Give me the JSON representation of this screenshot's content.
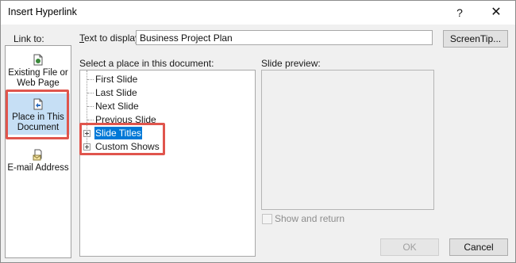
{
  "window": {
    "title": "Insert Hyperlink",
    "help_glyph": "?",
    "close_glyph": "✕"
  },
  "link_to": {
    "label": "Link to:",
    "items": [
      {
        "label": "Existing File or Web Page",
        "icon": "file-globe-icon",
        "selected": false
      },
      {
        "label": "Place in This Document",
        "icon": "document-place-icon",
        "selected": true
      },
      {
        "label": "E-mail Address",
        "icon": "email-icon",
        "selected": false
      }
    ]
  },
  "text_to_display": {
    "label": "Text to display:",
    "value": "Business Project Plan"
  },
  "screentip_label": "ScreenTip...",
  "place": {
    "label": "Select a place in this document:",
    "items": [
      {
        "label": "First Slide",
        "expandable": false,
        "selected": false
      },
      {
        "label": "Last Slide",
        "expandable": false,
        "selected": false
      },
      {
        "label": "Next Slide",
        "expandable": false,
        "selected": false
      },
      {
        "label": "Previous Slide",
        "expandable": false,
        "selected": false
      },
      {
        "label": "Slide Titles",
        "expandable": true,
        "selected": true
      },
      {
        "label": "Custom Shows",
        "expandable": true,
        "selected": false
      }
    ]
  },
  "preview": {
    "label": "Slide preview:",
    "show_and_return": "Show and return",
    "show_and_return_checked": false
  },
  "buttons": {
    "ok": "OK",
    "cancel": "Cancel"
  },
  "colors": {
    "highlight_box": "#e0554d",
    "selection": "#0078d7",
    "sidebar_selected": "#c6dff5"
  }
}
